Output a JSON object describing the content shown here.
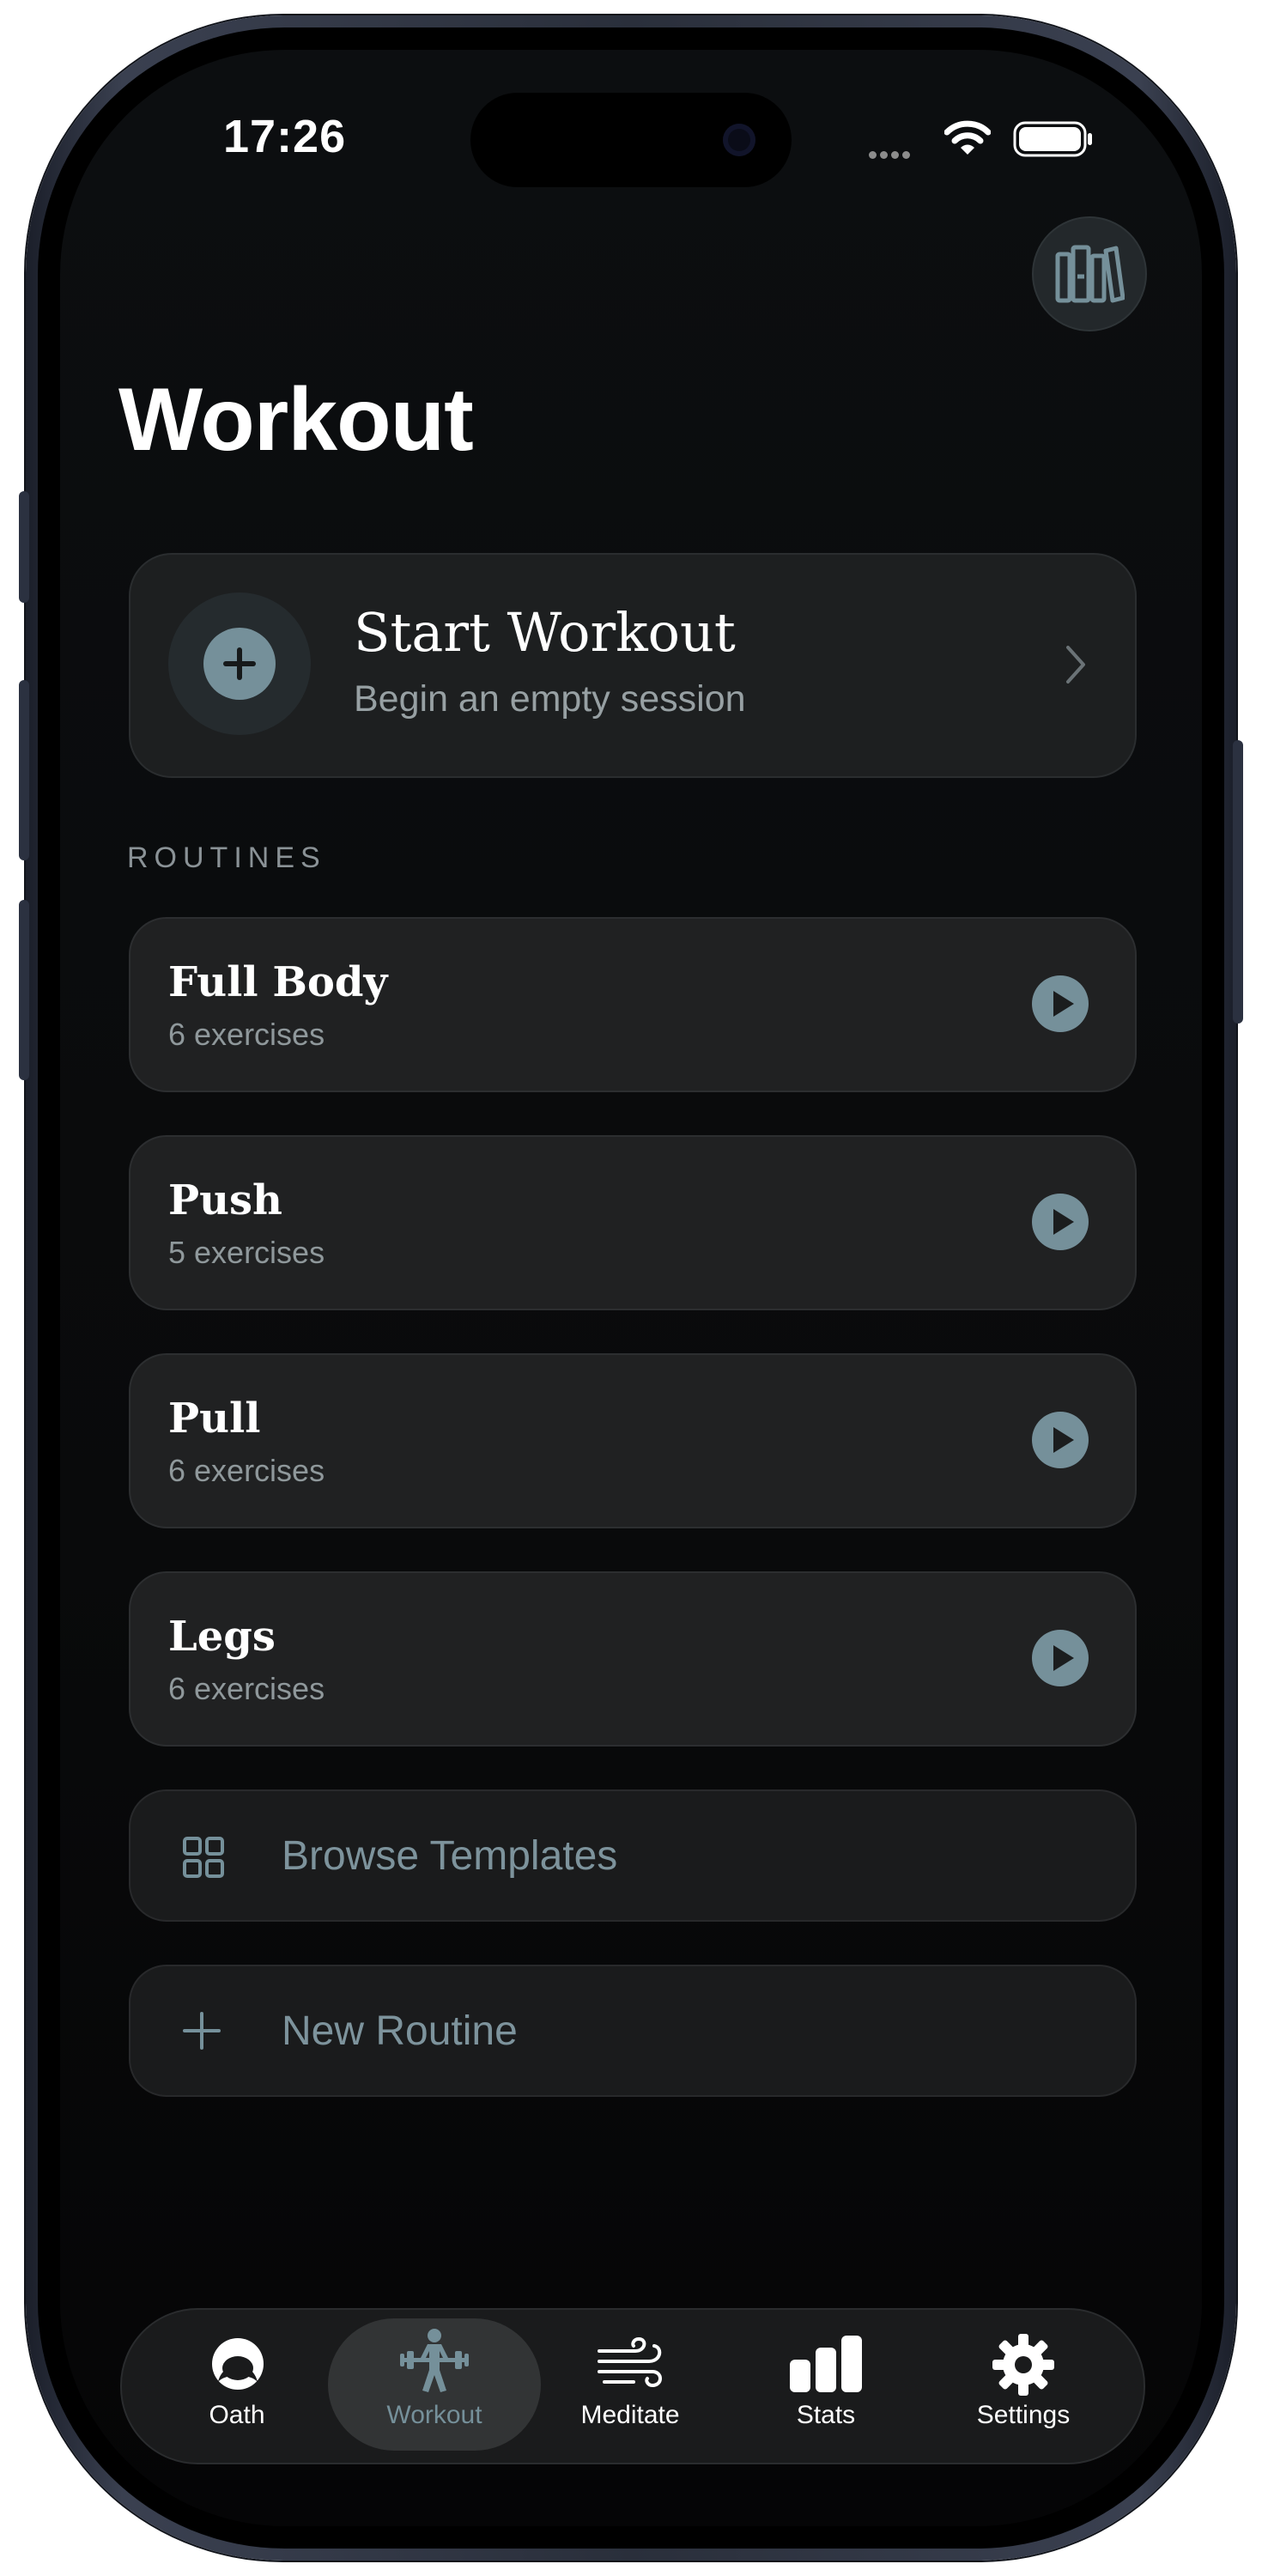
{
  "status_bar": {
    "time": "17:26"
  },
  "header": {
    "title": "Workout",
    "library_icon": "books-icon"
  },
  "start_card": {
    "title": "Start Workout",
    "subtitle": "Begin an empty session",
    "icon": "plus-circle-icon"
  },
  "routines_section": {
    "label": "ROUTINES"
  },
  "routines": [
    {
      "name": "Full Body",
      "count": "6 exercises"
    },
    {
      "name": "Push",
      "count": "5 exercises"
    },
    {
      "name": "Pull",
      "count": "6 exercises"
    },
    {
      "name": "Legs",
      "count": "6 exercises"
    }
  ],
  "actions": {
    "browse_templates": "Browse Templates",
    "new_routine": "New Routine"
  },
  "tabs": [
    {
      "label": "Oath",
      "icon": "oath-icon"
    },
    {
      "label": "Workout",
      "icon": "weightlifter-icon",
      "active": true
    },
    {
      "label": "Meditate",
      "icon": "wind-icon"
    },
    {
      "label": "Stats",
      "icon": "bar-chart-icon"
    },
    {
      "label": "Settings",
      "icon": "gear-icon"
    }
  ],
  "colors": {
    "accent": "#75909a",
    "background": "#0a0b0c",
    "card": "#202122"
  }
}
